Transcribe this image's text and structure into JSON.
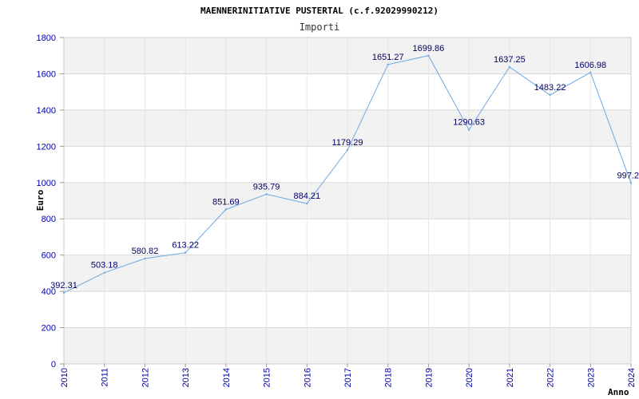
{
  "chart_data": {
    "type": "line",
    "title": "MAENNERINITIATIVE PUSTERTAL (c.f.92029990212)",
    "subtitle": "Importi",
    "xlabel": "Anno",
    "ylabel": "Euro",
    "ylim": [
      0,
      1800
    ],
    "yticks": [
      0,
      200,
      400,
      600,
      800,
      1000,
      1200,
      1400,
      1600,
      1800
    ],
    "grid": true,
    "x": [
      "2010",
      "2011",
      "2012",
      "2013",
      "2014",
      "2015",
      "2016",
      "2017",
      "2018",
      "2019",
      "2020",
      "2021",
      "2022",
      "2023",
      "2024"
    ],
    "series": [
      {
        "values": [
          392.31,
          503.18,
          580.82,
          613.22,
          851.69,
          935.79,
          884.21,
          1179.29,
          1651.27,
          1699.86,
          1290.63,
          1637.25,
          1483.22,
          1606.98,
          997.2
        ],
        "labels": [
          "392.31",
          "503.18",
          "580.82",
          "613.22",
          "851.69",
          "935.79",
          "884.21",
          "1179.29",
          "1651.27",
          "1699.86",
          "1290.63",
          "1637.25",
          "1483.22",
          "1606.98",
          "997.2"
        ]
      }
    ],
    "colors": {
      "line": "#6fa8e0",
      "band": "#f2f2f2",
      "grid": "#d8d8d8",
      "axis_text": "#0000aa",
      "label_text": "#000066"
    }
  }
}
